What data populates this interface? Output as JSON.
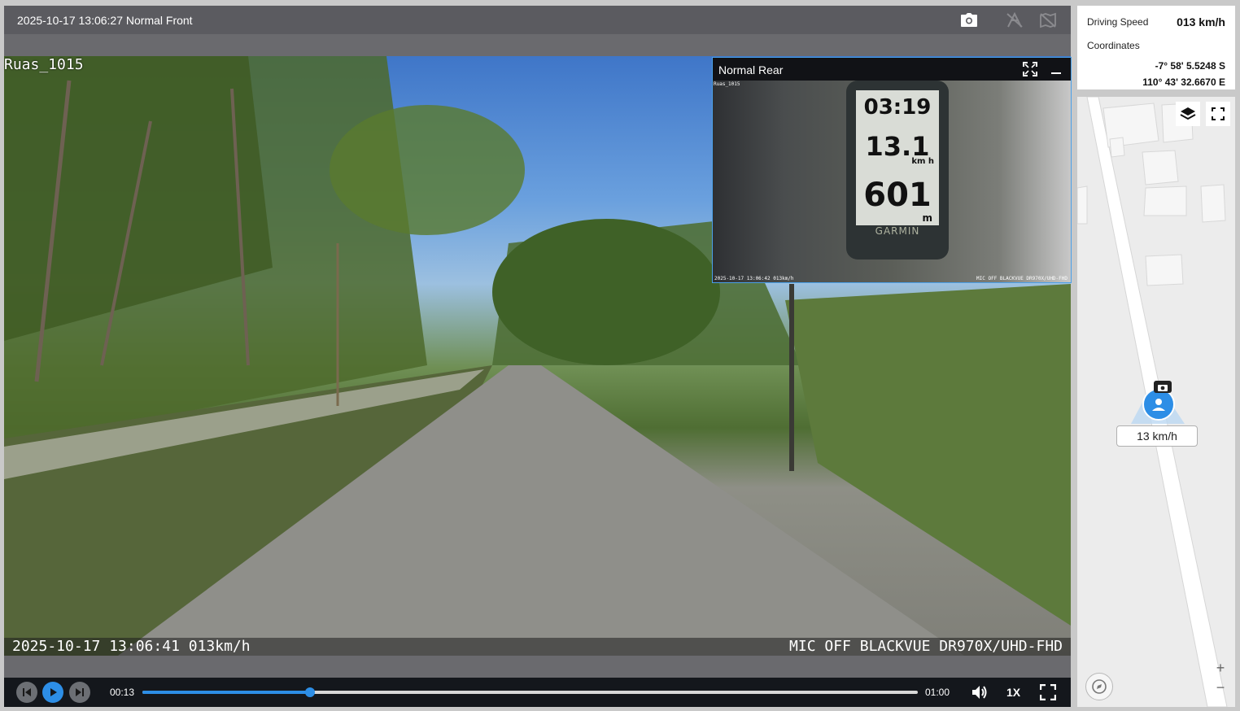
{
  "header": {
    "title": "2025-10-17 13:06:27 Normal Front",
    "icons": [
      "camera-icon",
      "no-gps-icon",
      "disabled-map-icon"
    ]
  },
  "front_video": {
    "overlay_top_left": "Ruas_1015",
    "overlay_timestamp": "2025-10-17 13:06:41 013km/h",
    "overlay_model": "MIC OFF BLACKVUE DR970X/UHD-FHD"
  },
  "rear_pip": {
    "title": "Normal Rear",
    "overlay_top_left": "Ruas_1015",
    "overlay_timestamp": "2025-10-17 13:06:42 013km/h",
    "overlay_model": "MIC OFF BLACKVUE DR970X/UHD-FHD",
    "device": {
      "time": "03:19",
      "speed": "13.1",
      "speed_unit": "km h",
      "distance": "601",
      "distance_unit": "m",
      "brand": "GARMIN"
    }
  },
  "player": {
    "current_time": "00:13",
    "duration": "01:00",
    "progress": 0.216,
    "rate": "1X",
    "accent": "#2d8ee6"
  },
  "info_panel": {
    "speed_label": "Driving Speed",
    "speed_value": "013 km/h",
    "coords_label": "Coordinates",
    "lat": "-7° 58' 5.5248 S",
    "lon": "110° 43' 32.6670 E"
  },
  "map": {
    "speed_tag": "13 km/h",
    "zoom_in": "+",
    "zoom_out": "−"
  }
}
